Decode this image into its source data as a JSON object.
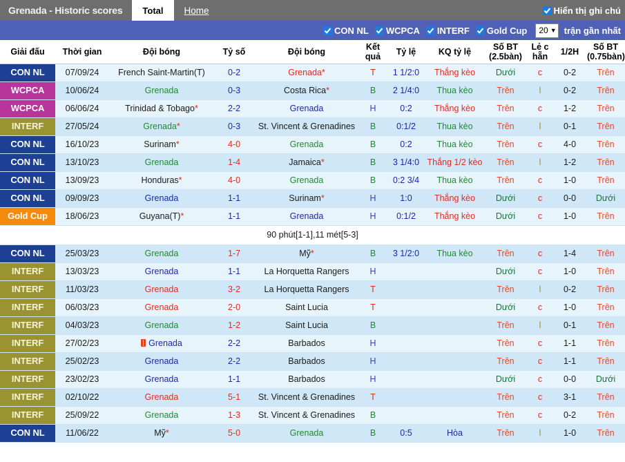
{
  "topbar": {
    "title": "Grenada - Historic scores",
    "tabs": [
      {
        "label": "Total",
        "active": true
      },
      {
        "label": "Home",
        "active": false
      }
    ],
    "show_notes_label": "Hiển thị ghi chú",
    "show_notes_checked": true
  },
  "filterbar": {
    "filters": [
      {
        "label": "CON NL",
        "checked": true
      },
      {
        "label": "WCPCA",
        "checked": true
      },
      {
        "label": "INTERF",
        "checked": true
      },
      {
        "label": "Gold Cup",
        "checked": true
      }
    ],
    "match_count": "20",
    "suffix_label": "trận gần nhất"
  },
  "table": {
    "columns": [
      "Giải đấu",
      "Thời gian",
      "Đội bóng",
      "Tỷ số",
      "Đội bóng",
      "Kết quả",
      "Tỷ lệ",
      "KQ tỷ lệ",
      "Số BT (2.5bàn)",
      "Lẻ c hẵn",
      "1/2H",
      "Số BT (0.75bàn)"
    ],
    "rows": [
      {
        "league": "CON NL",
        "league_class": "lg-connl",
        "date": "07/09/24",
        "home": "French Saint-Martin(T)",
        "home_class": "c-black",
        "home_star": false,
        "score": "0-2",
        "score_class": "c-blue",
        "away": "Grenada",
        "away_class": "c-red",
        "away_star": true,
        "result": "T",
        "result_class": "c-red",
        "odds": "1 1/2:0",
        "odds_class": "c-blue",
        "kq": "Thắng kèo",
        "kq_class": "c-red",
        "bt25": "Dưới",
        "bt25_class": "c-dgreen",
        "oddeven": "c",
        "oddeven_class": "c-red",
        "half": "0-2",
        "half_class": "c-black",
        "bt075": "Trên",
        "bt075_class": "c-orange",
        "redcard": false
      },
      {
        "league": "WCPCA",
        "league_class": "lg-wcpca",
        "date": "10/06/24",
        "home": "Grenada",
        "home_class": "c-green",
        "home_star": false,
        "score": "0-3",
        "score_class": "c-blue",
        "away": "Costa Rica",
        "away_class": "c-black",
        "away_star": true,
        "result": "B",
        "result_class": "c-green",
        "odds": "2 1/4:0",
        "odds_class": "c-blue",
        "kq": "Thua kèo",
        "kq_class": "c-green",
        "bt25": "Trên",
        "bt25_class": "c-orange",
        "oddeven": "l",
        "oddeven_class": "c-olive",
        "half": "0-2",
        "half_class": "c-black",
        "bt075": "Trên",
        "bt075_class": "c-orange",
        "redcard": false
      },
      {
        "league": "WCPCA",
        "league_class": "lg-wcpca",
        "date": "06/06/24",
        "home": "Trinidad & Tobago",
        "home_class": "c-black",
        "home_star": true,
        "score": "2-2",
        "score_class": "c-blue",
        "away": "Grenada",
        "away_class": "c-blue",
        "away_star": false,
        "result": "H",
        "result_class": "c-purple",
        "odds": "0:2",
        "odds_class": "c-blue",
        "kq": "Thắng kèo",
        "kq_class": "c-red",
        "bt25": "Trên",
        "bt25_class": "c-orange",
        "oddeven": "c",
        "oddeven_class": "c-red",
        "half": "1-2",
        "half_class": "c-black",
        "bt075": "Trên",
        "bt075_class": "c-orange",
        "redcard": false
      },
      {
        "league": "INTERF",
        "league_class": "lg-interf",
        "date": "27/05/24",
        "home": "Grenada",
        "home_class": "c-green",
        "home_star": true,
        "score": "0-3",
        "score_class": "c-blue",
        "away": "St. Vincent & Grenadines",
        "away_class": "c-black",
        "away_star": false,
        "result": "B",
        "result_class": "c-green",
        "odds": "0:1/2",
        "odds_class": "c-blue",
        "kq": "Thua kèo",
        "kq_class": "c-green",
        "bt25": "Trên",
        "bt25_class": "c-orange",
        "oddeven": "l",
        "oddeven_class": "c-olive",
        "half": "0-1",
        "half_class": "c-black",
        "bt075": "Trên",
        "bt075_class": "c-orange",
        "redcard": false
      },
      {
        "league": "CON NL",
        "league_class": "lg-connl",
        "date": "16/10/23",
        "home": "Surinam",
        "home_class": "c-black",
        "home_star": true,
        "score": "4-0",
        "score_class": "c-red",
        "away": "Grenada",
        "away_class": "c-green",
        "away_star": false,
        "result": "B",
        "result_class": "c-green",
        "odds": "0:2",
        "odds_class": "c-blue",
        "kq": "Thua kèo",
        "kq_class": "c-green",
        "bt25": "Trên",
        "bt25_class": "c-orange",
        "oddeven": "c",
        "oddeven_class": "c-red",
        "half": "4-0",
        "half_class": "c-black",
        "bt075": "Trên",
        "bt075_class": "c-orange",
        "redcard": false
      },
      {
        "league": "CON NL",
        "league_class": "lg-connl",
        "date": "13/10/23",
        "home": "Grenada",
        "home_class": "c-green",
        "home_star": false,
        "score": "1-4",
        "score_class": "c-red",
        "away": "Jamaica",
        "away_class": "c-black",
        "away_star": true,
        "result": "B",
        "result_class": "c-green",
        "odds": "3 1/4:0",
        "odds_class": "c-blue",
        "kq": "Thắng 1/2 kèo",
        "kq_class": "c-red",
        "bt25": "Trên",
        "bt25_class": "c-orange",
        "oddeven": "l",
        "oddeven_class": "c-olive",
        "half": "1-2",
        "half_class": "c-black",
        "bt075": "Trên",
        "bt075_class": "c-orange",
        "redcard": false
      },
      {
        "league": "CON NL",
        "league_class": "lg-connl",
        "date": "13/09/23",
        "home": "Honduras",
        "home_class": "c-black",
        "home_star": true,
        "score": "4-0",
        "score_class": "c-red",
        "away": "Grenada",
        "away_class": "c-green",
        "away_star": false,
        "result": "B",
        "result_class": "c-green",
        "odds": "0:2 3/4",
        "odds_class": "c-blue",
        "kq": "Thua kèo",
        "kq_class": "c-green",
        "bt25": "Trên",
        "bt25_class": "c-orange",
        "oddeven": "c",
        "oddeven_class": "c-red",
        "half": "1-0",
        "half_class": "c-black",
        "bt075": "Trên",
        "bt075_class": "c-orange",
        "redcard": false
      },
      {
        "league": "CON NL",
        "league_class": "lg-connl",
        "date": "09/09/23",
        "home": "Grenada",
        "home_class": "c-blue",
        "home_star": false,
        "score": "1-1",
        "score_class": "c-blue",
        "away": "Surinam",
        "away_class": "c-black",
        "away_star": true,
        "result": "H",
        "result_class": "c-purple",
        "odds": "1:0",
        "odds_class": "c-blue",
        "kq": "Thắng kèo",
        "kq_class": "c-red",
        "bt25": "Dưới",
        "bt25_class": "c-dgreen",
        "oddeven": "c",
        "oddeven_class": "c-red",
        "half": "0-0",
        "half_class": "c-black",
        "bt075": "Dưới",
        "bt075_class": "c-dgreen",
        "redcard": false
      },
      {
        "league": "Gold Cup",
        "league_class": "lg-goldcup",
        "date": "18/06/23",
        "home": "Guyana(T)",
        "home_class": "c-black",
        "home_star": true,
        "score": "1-1",
        "score_class": "c-blue",
        "away": "Grenada",
        "away_class": "c-blue",
        "away_star": false,
        "result": "H",
        "result_class": "c-purple",
        "odds": "0:1/2",
        "odds_class": "c-blue",
        "kq": "Thắng kèo",
        "kq_class": "c-red",
        "bt25": "Dưới",
        "bt25_class": "c-dgreen",
        "oddeven": "c",
        "oddeven_class": "c-red",
        "half": "1-0",
        "half_class": "c-black",
        "bt075": "Trên",
        "bt075_class": "c-orange",
        "redcard": false
      },
      {
        "note": "90 phút[1-1],11 mét[5-3]"
      },
      {
        "league": "CON NL",
        "league_class": "lg-connl",
        "date": "25/03/23",
        "home": "Grenada",
        "home_class": "c-green",
        "home_star": false,
        "score": "1-7",
        "score_class": "c-red",
        "away": "Mỹ",
        "away_class": "c-black",
        "away_star": true,
        "result": "B",
        "result_class": "c-green",
        "odds": "3 1/2:0",
        "odds_class": "c-blue",
        "kq": "Thua kèo",
        "kq_class": "c-green",
        "bt25": "Trên",
        "bt25_class": "c-orange",
        "oddeven": "c",
        "oddeven_class": "c-red",
        "half": "1-4",
        "half_class": "c-black",
        "bt075": "Trên",
        "bt075_class": "c-orange",
        "redcard": false
      },
      {
        "league": "INTERF",
        "league_class": "lg-interf",
        "date": "13/03/23",
        "home": "Grenada",
        "home_class": "c-blue",
        "home_star": false,
        "score": "1-1",
        "score_class": "c-blue",
        "away": "La Horquetta Rangers",
        "away_class": "c-black",
        "away_star": false,
        "result": "H",
        "result_class": "c-purple",
        "odds": "",
        "odds_class": "c-blue",
        "kq": "",
        "kq_class": "c-red",
        "bt25": "Dưới",
        "bt25_class": "c-dgreen",
        "oddeven": "c",
        "oddeven_class": "c-red",
        "half": "1-0",
        "half_class": "c-black",
        "bt075": "Trên",
        "bt075_class": "c-orange",
        "redcard": false
      },
      {
        "league": "INTERF",
        "league_class": "lg-interf",
        "date": "11/03/23",
        "home": "Grenada",
        "home_class": "c-red",
        "home_star": false,
        "score": "3-2",
        "score_class": "c-red",
        "away": "La Horquetta Rangers",
        "away_class": "c-black",
        "away_star": false,
        "result": "T",
        "result_class": "c-red",
        "odds": "",
        "odds_class": "c-blue",
        "kq": "",
        "kq_class": "c-red",
        "bt25": "Trên",
        "bt25_class": "c-orange",
        "oddeven": "l",
        "oddeven_class": "c-olive",
        "half": "0-2",
        "half_class": "c-black",
        "bt075": "Trên",
        "bt075_class": "c-orange",
        "redcard": false
      },
      {
        "league": "INTERF",
        "league_class": "lg-interf",
        "date": "06/03/23",
        "home": "Grenada",
        "home_class": "c-red",
        "home_star": false,
        "score": "2-0",
        "score_class": "c-red",
        "away": "Saint Lucia",
        "away_class": "c-black",
        "away_star": false,
        "result": "T",
        "result_class": "c-red",
        "odds": "",
        "odds_class": "c-blue",
        "kq": "",
        "kq_class": "c-red",
        "bt25": "Dưới",
        "bt25_class": "c-dgreen",
        "oddeven": "c",
        "oddeven_class": "c-red",
        "half": "1-0",
        "half_class": "c-black",
        "bt075": "Trên",
        "bt075_class": "c-orange",
        "redcard": false
      },
      {
        "league": "INTERF",
        "league_class": "lg-interf",
        "date": "04/03/23",
        "home": "Grenada",
        "home_class": "c-green",
        "home_star": false,
        "score": "1-2",
        "score_class": "c-red",
        "away": "Saint Lucia",
        "away_class": "c-black",
        "away_star": false,
        "result": "B",
        "result_class": "c-green",
        "odds": "",
        "odds_class": "c-blue",
        "kq": "",
        "kq_class": "c-red",
        "bt25": "Trên",
        "bt25_class": "c-orange",
        "oddeven": "l",
        "oddeven_class": "c-olive",
        "half": "0-1",
        "half_class": "c-black",
        "bt075": "Trên",
        "bt075_class": "c-orange",
        "redcard": false
      },
      {
        "league": "INTERF",
        "league_class": "lg-interf",
        "date": "27/02/23",
        "home": "Grenada",
        "home_class": "c-blue",
        "home_star": false,
        "score": "2-2",
        "score_class": "c-blue",
        "away": "Barbados",
        "away_class": "c-black",
        "away_star": false,
        "result": "H",
        "result_class": "c-purple",
        "odds": "",
        "odds_class": "c-blue",
        "kq": "",
        "kq_class": "c-red",
        "bt25": "Trên",
        "bt25_class": "c-orange",
        "oddeven": "c",
        "oddeven_class": "c-red",
        "half": "1-1",
        "half_class": "c-black",
        "bt075": "Trên",
        "bt075_class": "c-orange",
        "redcard": true
      },
      {
        "league": "INTERF",
        "league_class": "lg-interf",
        "date": "25/02/23",
        "home": "Grenada",
        "home_class": "c-blue",
        "home_star": false,
        "score": "2-2",
        "score_class": "c-blue",
        "away": "Barbados",
        "away_class": "c-black",
        "away_star": false,
        "result": "H",
        "result_class": "c-purple",
        "odds": "",
        "odds_class": "c-blue",
        "kq": "",
        "kq_class": "c-red",
        "bt25": "Trên",
        "bt25_class": "c-orange",
        "oddeven": "c",
        "oddeven_class": "c-red",
        "half": "1-1",
        "half_class": "c-black",
        "bt075": "Trên",
        "bt075_class": "c-orange",
        "redcard": false
      },
      {
        "league": "INTERF",
        "league_class": "lg-interf",
        "date": "23/02/23",
        "home": "Grenada",
        "home_class": "c-blue",
        "home_star": false,
        "score": "1-1",
        "score_class": "c-blue",
        "away": "Barbados",
        "away_class": "c-black",
        "away_star": false,
        "result": "H",
        "result_class": "c-purple",
        "odds": "",
        "odds_class": "c-blue",
        "kq": "",
        "kq_class": "c-red",
        "bt25": "Dưới",
        "bt25_class": "c-dgreen",
        "oddeven": "c",
        "oddeven_class": "c-red",
        "half": "0-0",
        "half_class": "c-black",
        "bt075": "Dưới",
        "bt075_class": "c-dgreen",
        "redcard": false
      },
      {
        "league": "INTERF",
        "league_class": "lg-interf",
        "date": "02/10/22",
        "home": "Grenada",
        "home_class": "c-red",
        "home_star": false,
        "score": "5-1",
        "score_class": "c-red",
        "away": "St. Vincent & Grenadines",
        "away_class": "c-black",
        "away_star": false,
        "result": "T",
        "result_class": "c-red",
        "odds": "",
        "odds_class": "c-blue",
        "kq": "",
        "kq_class": "c-red",
        "bt25": "Trên",
        "bt25_class": "c-orange",
        "oddeven": "c",
        "oddeven_class": "c-red",
        "half": "3-1",
        "half_class": "c-black",
        "bt075": "Trên",
        "bt075_class": "c-orange",
        "redcard": false
      },
      {
        "league": "INTERF",
        "league_class": "lg-interf",
        "date": "25/09/22",
        "home": "Grenada",
        "home_class": "c-green",
        "home_star": false,
        "score": "1-3",
        "score_class": "c-red",
        "away": "St. Vincent & Grenadines",
        "away_class": "c-black",
        "away_star": false,
        "result": "B",
        "result_class": "c-green",
        "odds": "",
        "odds_class": "c-blue",
        "kq": "",
        "kq_class": "c-red",
        "bt25": "Trên",
        "bt25_class": "c-orange",
        "oddeven": "c",
        "oddeven_class": "c-red",
        "half": "0-2",
        "half_class": "c-black",
        "bt075": "Trên",
        "bt075_class": "c-orange",
        "redcard": false
      },
      {
        "league": "CON NL",
        "league_class": "lg-connl",
        "date": "11/06/22",
        "home": "Mỹ",
        "home_class": "c-black",
        "home_star": true,
        "score": "5-0",
        "score_class": "c-red",
        "away": "Grenada",
        "away_class": "c-green",
        "away_star": false,
        "result": "B",
        "result_class": "c-green",
        "odds": "0:5",
        "odds_class": "c-blue",
        "kq": "Hòa",
        "kq_class": "c-blue",
        "bt25": "Trên",
        "bt25_class": "c-orange",
        "oddeven": "l",
        "oddeven_class": "c-olive",
        "half": "1-0",
        "half_class": "c-black",
        "bt075": "Trên",
        "bt075_class": "c-orange",
        "redcard": false
      }
    ]
  }
}
